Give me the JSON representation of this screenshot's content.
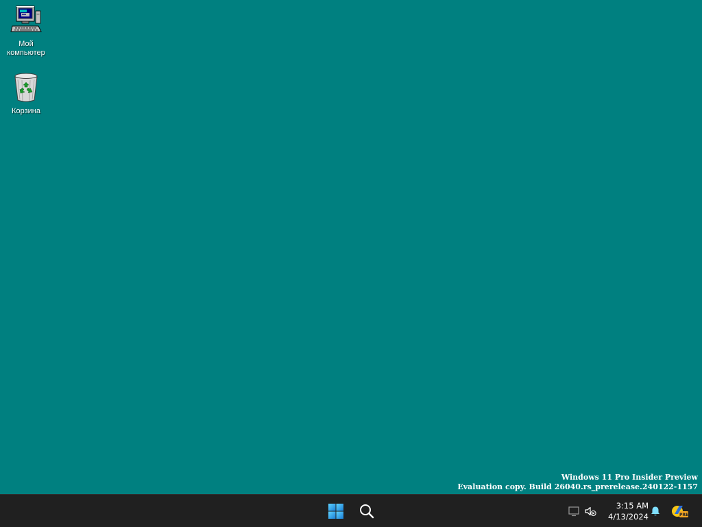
{
  "desktop": {
    "background_color": "#008080",
    "icons": [
      {
        "label": "Мой компьютер",
        "icon": "my-computer-icon"
      },
      {
        "label": "Корзина",
        "icon": "recycle-bin-icon"
      }
    ]
  },
  "watermark": {
    "line1": "Windows 11 Pro Insider Preview",
    "line2": "Evaluation copy. Build 26040.rs_prerelease.240122-1157"
  },
  "taskbar": {
    "background_color": "#202020",
    "start_icon": "windows-start-icon",
    "search_icon": "search-icon",
    "tray": {
      "network_icon": "network-disconnected-icon",
      "volume_icon": "volume-muted-icon",
      "time": "3:15 AM",
      "date": "4/13/2024",
      "notification_icon": "bell-icon",
      "insider_badge_icon": "insider-pre-icon",
      "insider_badge_text": "PRE"
    }
  }
}
